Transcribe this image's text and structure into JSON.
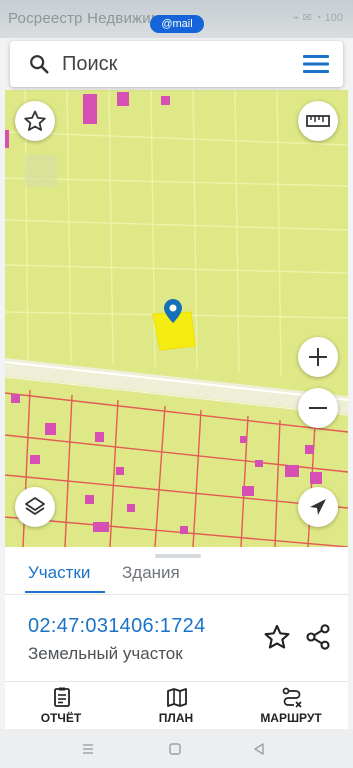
{
  "status_bar": {
    "title": "Росреестр Недвижимости",
    "pill_label": "@mail",
    "icons": "⌁ ✉ ◔ 100"
  },
  "search": {
    "placeholder": "Поиск",
    "icon": "search-icon",
    "menu_icon": "menu-icon"
  },
  "map": {
    "controls": {
      "favorites": "star-icon",
      "ruler": "ruler-icon",
      "zoom_in": "plus-icon",
      "zoom_out": "minus-icon",
      "layers": "layers-icon",
      "locate": "navigation-arrow-icon"
    },
    "marker": "location-pin-icon",
    "colors": {
      "land": "#dfe886",
      "parcel_border": "#e35b55",
      "building": "#d64fb2",
      "selected": "#f5ec12",
      "marker": "#1572b8"
    }
  },
  "panel": {
    "tabs": [
      {
        "label": "Участки",
        "active": true
      },
      {
        "label": "Здания",
        "active": false
      }
    ],
    "cadastral_number": "02:47:031406:1724",
    "parcel_type": "Земельный участок",
    "favorite_icon": "star-outline-icon",
    "share_icon": "share-icon"
  },
  "bottom_nav": [
    {
      "label": "ОТЧЁТ",
      "icon": "report-icon"
    },
    {
      "label": "ПЛАН",
      "icon": "map-plan-icon"
    },
    {
      "label": "МАРШРУТ",
      "icon": "route-icon"
    }
  ],
  "system_nav": {
    "recent": "recent-apps-icon",
    "home": "home-icon",
    "back": "back-icon"
  },
  "accent_color": "#1a73c9"
}
